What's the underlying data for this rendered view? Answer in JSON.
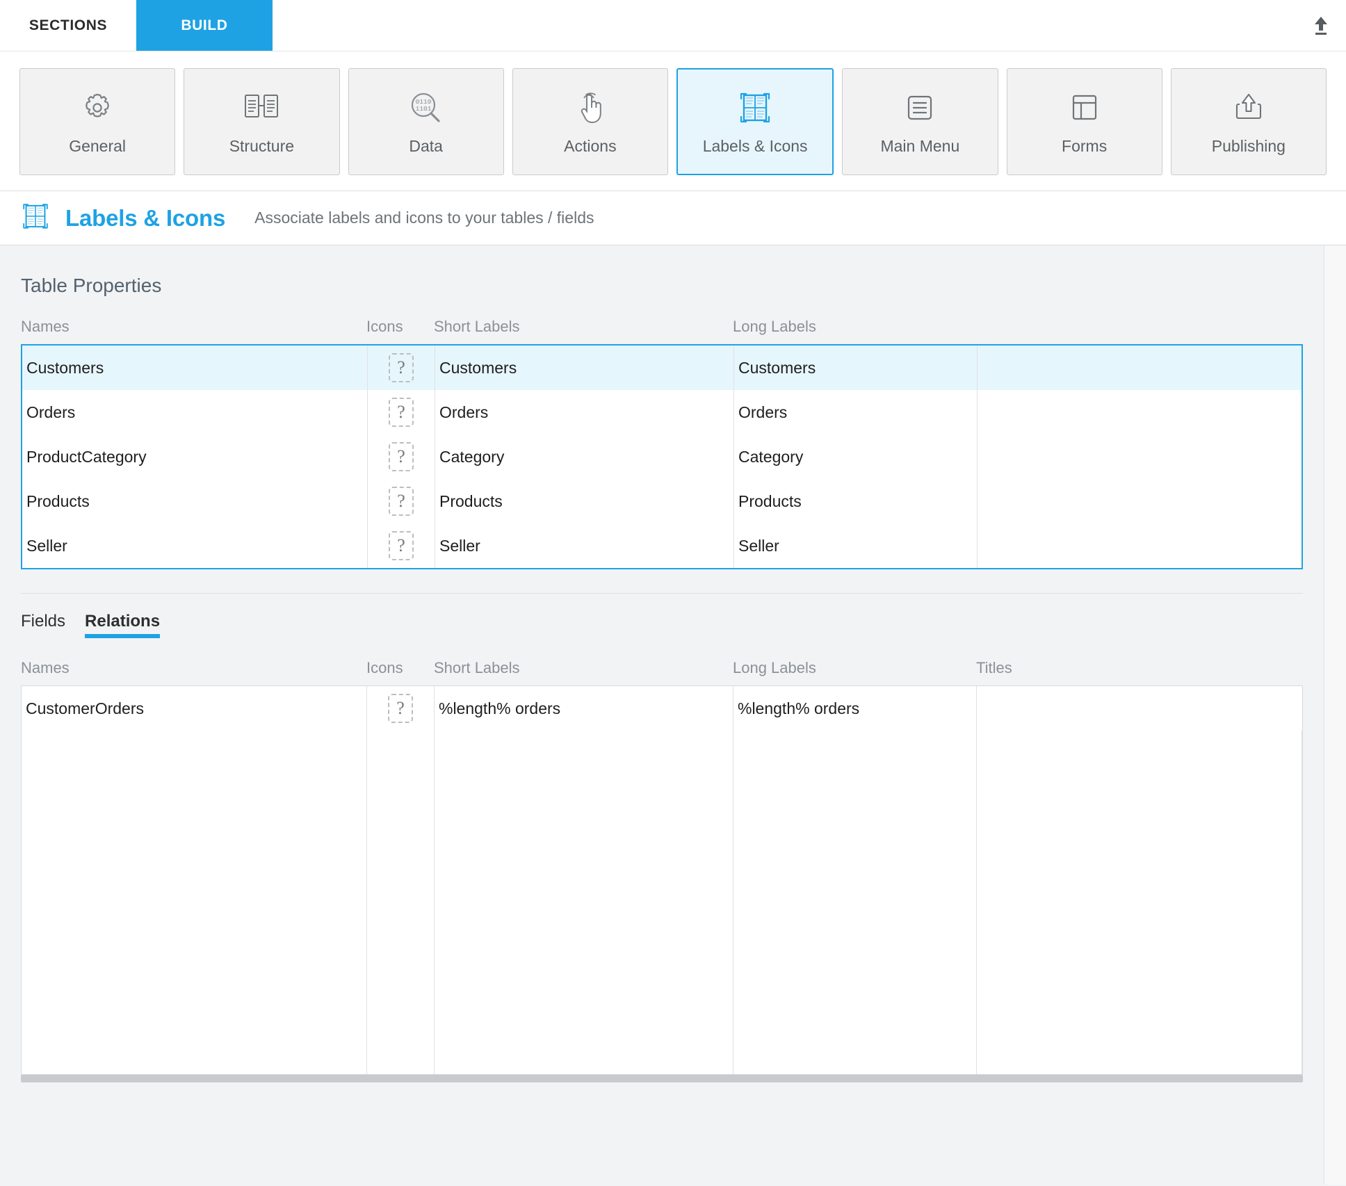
{
  "topbar": {
    "tabs": [
      {
        "label": "SECTIONS",
        "active": false
      },
      {
        "label": "BUILD",
        "active": true
      }
    ],
    "upload_icon": "upload-icon"
  },
  "sections": {
    "buttons": [
      {
        "label": "General",
        "icon": "gear-icon",
        "active": false
      },
      {
        "label": "Structure",
        "icon": "linked-documents-icon",
        "active": false
      },
      {
        "label": "Data",
        "icon": "binary-magnifier-icon",
        "active": false
      },
      {
        "label": "Actions",
        "icon": "tap-hand-icon",
        "active": false
      },
      {
        "label": "Labels & Icons",
        "icon": "labels-grid-icon",
        "active": true
      },
      {
        "label": "Main Menu",
        "icon": "hamburger-box-icon",
        "active": false
      },
      {
        "label": "Forms",
        "icon": "layout-panel-icon",
        "active": false
      },
      {
        "label": "Publishing",
        "icon": "upload-box-icon",
        "active": false
      }
    ]
  },
  "page_header": {
    "icon": "labels-grid-icon",
    "title": "Labels & Icons",
    "subtitle": "Associate labels and icons to your tables / fields"
  },
  "table_properties": {
    "section_title": "Table Properties",
    "columns": [
      "Names",
      "Icons",
      "Short Labels",
      "Long Labels",
      ""
    ],
    "rows": [
      {
        "name": "Customers",
        "icon": "?",
        "short": "Customers",
        "long": "Customers",
        "title": "",
        "selected": true
      },
      {
        "name": "Orders",
        "icon": "?",
        "short": "Orders",
        "long": "Orders",
        "title": "",
        "selected": false
      },
      {
        "name": "ProductCategory",
        "icon": "?",
        "short": "Category",
        "long": "Category",
        "title": "",
        "selected": false
      },
      {
        "name": "Products",
        "icon": "?",
        "short": "Products",
        "long": "Products",
        "title": "",
        "selected": false
      },
      {
        "name": "Seller",
        "icon": "?",
        "short": "Seller",
        "long": "Seller",
        "title": "",
        "selected": false
      }
    ]
  },
  "sub_tabs": [
    {
      "label": "Fields",
      "active": false
    },
    {
      "label": "Relations",
      "active": true
    }
  ],
  "relations": {
    "columns": [
      "Names",
      "Icons",
      "Short Labels",
      "Long Labels",
      "Titles"
    ],
    "rows": [
      {
        "name": "CustomerOrders",
        "icon": "?",
        "short": "%length% orders",
        "long": "%length% orders",
        "title": ""
      }
    ]
  },
  "colors": {
    "accent": "#1ea2e4",
    "selected_row": "#e6f6fd",
    "page_bg": "#f2f3f5",
    "panel_bg": "#ffffff"
  }
}
